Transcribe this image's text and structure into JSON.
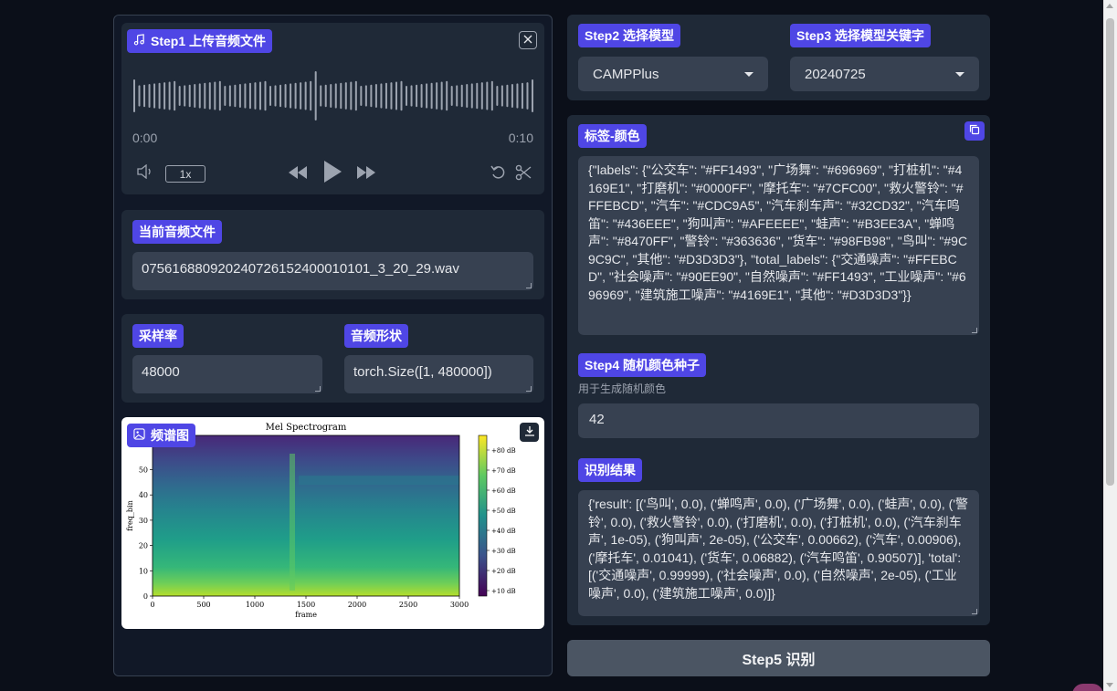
{
  "audio": {
    "label": "Step1 上传音频文件",
    "time_current": "0:00",
    "time_total": "0:10",
    "speed": "1x",
    "waveform_progress": 0.46
  },
  "file": {
    "label": "当前音频文件",
    "value": "075616880920240726152400010101_3_20_29.wav"
  },
  "sample_rate": {
    "label": "采样率",
    "value": "48000"
  },
  "shape": {
    "label": "音频形状",
    "value": "torch.Size([1, 480000])"
  },
  "spectrogram": {
    "label": "频谱图",
    "title": "Mel Spectrogram",
    "xlabel": "frame",
    "ylabel": "freq_bin",
    "xticks": [
      "0",
      "500",
      "1000",
      "1500",
      "2000",
      "2500",
      "3000"
    ],
    "yticks": [
      "0",
      "10",
      "20",
      "30",
      "40",
      "50"
    ],
    "cbar_ticks": [
      "+80 dB",
      "+70 dB",
      "+60 dB",
      "+50 dB",
      "+40 dB",
      "+30 dB",
      "+20 dB",
      "+10 dB"
    ]
  },
  "model": {
    "label": "Step2 选择模型",
    "value": "CAMPPlus"
  },
  "keyword": {
    "label": "Step3 选择模型关键字",
    "value": "20240725"
  },
  "labels_colors": {
    "label": "标签-颜色",
    "value": "{\"labels\": {\"公交车\": \"#FF1493\", \"广场舞\": \"#696969\", \"打桩机\": \"#4169E1\", \"打磨机\": \"#0000FF\", \"摩托车\": \"#7CFC00\", \"救火警铃\": \"#FFEBCD\", \"汽车\": \"#CDC9A5\", \"汽车刹车声\": \"#32CD32\", \"汽车鸣笛\": \"#436EEE\", \"狗叫声\": \"#AFEEEE\", \"蛙声\": \"#B3EE3A\", \"蝉鸣声\": \"#8470FF\", \"警铃\": \"#363636\", \"货车\": \"#98FB98\", \"鸟叫\": \"#9C9C9C\", \"其他\": \"#D3D3D3\"}, \"total_labels\": {\"交通噪声\": \"#FFEBCD\", \"社会噪声\": \"#90EE90\", \"自然噪声\": \"#FF1493\", \"工业噪声\": \"#696969\", \"建筑施工噪声\": \"#4169E1\", \"其他\": \"#D3D3D3\"}}"
  },
  "seed": {
    "label": "Step4 随机颜色种子",
    "info": "用于生成随机颜色",
    "value": "42"
  },
  "result": {
    "label": "识别结果",
    "value": "{'result': [('鸟叫', 0.0), ('蝉鸣声', 0.0), ('广场舞', 0.0), ('蛙声', 0.0), ('警铃', 0.0), ('救火警铃', 0.0), ('打磨机', 0.0), ('打桩机', 0.0), ('汽车刹车声', 1e-05), ('狗叫声', 2e-05), ('公交车', 0.00662), ('汽车', 0.00906), ('摩托车', 0.01041), ('货车', 0.06882), ('汽车鸣笛', 0.90507)], 'total': [('交通噪声', 0.99999), ('社会噪声', 0.0), ('自然噪声', 2e-05), ('工业噪声', 0.0), ('建筑施工噪声', 0.0)]}"
  },
  "submit": {
    "label": "Step5 识别"
  },
  "colors": {
    "accent": "#4f46e5",
    "panel": "#1f2937",
    "input": "#374151",
    "background": "#0b0f19"
  }
}
